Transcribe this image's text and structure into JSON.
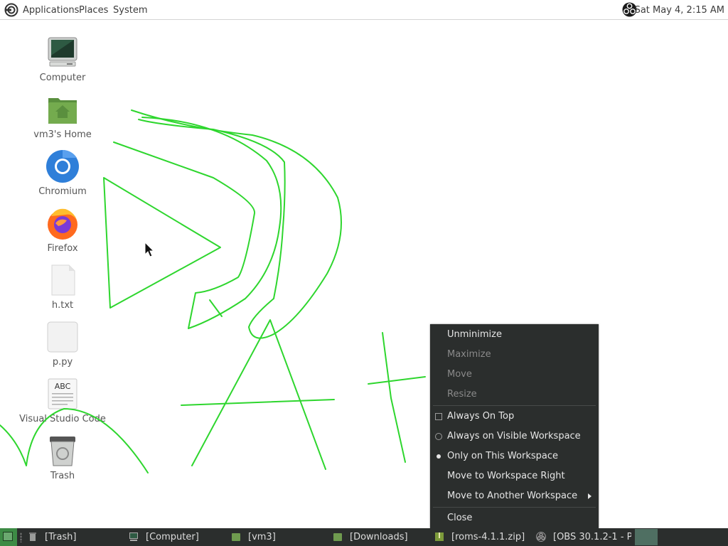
{
  "top_panel": {
    "menus": [
      "Applications",
      "Places",
      "System"
    ],
    "clock": "Sat May  4,  2:15 AM"
  },
  "desktop_icons": [
    {
      "label": "Computer",
      "icon": "computer-icon"
    },
    {
      "label": "vm3's Home",
      "icon": "home-folder-icon"
    },
    {
      "label": "Chromium",
      "icon": "chromium-icon"
    },
    {
      "label": "Firefox",
      "icon": "firefox-icon"
    },
    {
      "label": "h.txt",
      "icon": "text-file-icon"
    },
    {
      "label": "p.py",
      "icon": "python-file-icon"
    },
    {
      "label": "Visual Studio Code",
      "icon": "document-abc-icon"
    },
    {
      "label": "Trash",
      "icon": "trash-icon"
    }
  ],
  "context_menu": {
    "items": [
      {
        "label": "Unminimize",
        "enabled": true
      },
      {
        "label": "Maximize",
        "enabled": false
      },
      {
        "label": "Move",
        "enabled": false
      },
      {
        "label": "Resize",
        "enabled": false
      },
      {
        "label": "Always On Top",
        "enabled": true,
        "mark": "checkbox",
        "checked": false
      },
      {
        "label": "Always on Visible Workspace",
        "enabled": true,
        "mark": "radio",
        "checked": false
      },
      {
        "label": "Only on This Workspace",
        "enabled": true,
        "mark": "radio",
        "checked": true
      },
      {
        "label": "Move to Workspace Right",
        "enabled": true
      },
      {
        "label": "Move to Another Workspace",
        "enabled": true,
        "submenu": true
      },
      {
        "label": "Close",
        "enabled": true
      }
    ]
  },
  "taskbar": {
    "tasks": [
      {
        "label": "[Trash]",
        "icon": "trash-icon"
      },
      {
        "label": "[Computer]",
        "icon": "computer-icon"
      },
      {
        "label": "[vm3]",
        "icon": "folder-icon"
      },
      {
        "label": "[Downloads]",
        "icon": "folder-icon"
      },
      {
        "label": "[roms-4.1.1.zip]",
        "icon": "archive-icon"
      },
      {
        "label": "[OBS 30.1.2-1 - P...",
        "icon": "obs-icon"
      }
    ]
  },
  "colors": {
    "drawing_stroke": "#2ed62e",
    "panel_dark": "#2b2e2d",
    "accent_green": "#3d8b45"
  }
}
